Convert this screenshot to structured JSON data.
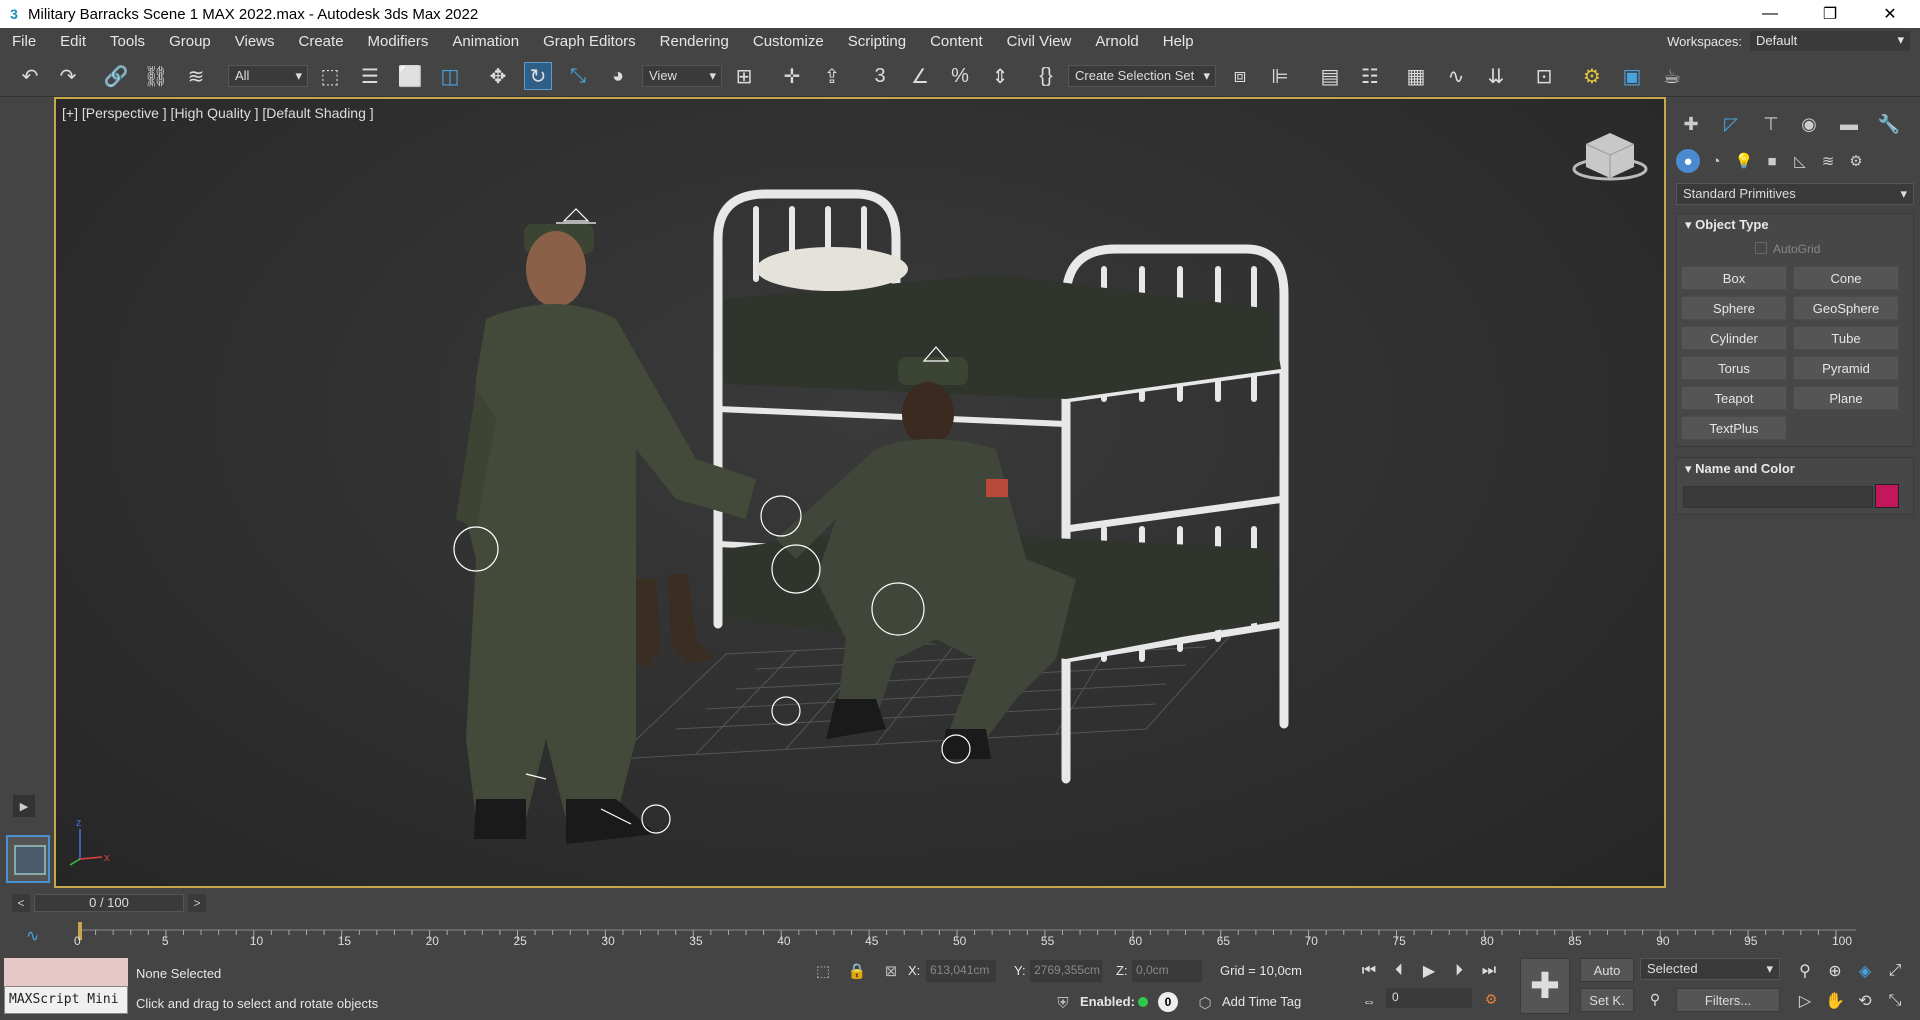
{
  "window": {
    "title": "Military Barracks Scene 1 MAX 2022.max - Autodesk 3ds Max 2022",
    "app_icon": "3",
    "minimize": "—",
    "maximize": "❐",
    "close": "✕"
  },
  "menu": {
    "items": [
      "File",
      "Edit",
      "Tools",
      "Group",
      "Views",
      "Create",
      "Modifiers",
      "Animation",
      "Graph Editors",
      "Rendering",
      "Customize",
      "Scripting",
      "Content",
      "Civil View",
      "Arnold",
      "Help"
    ],
    "workspaces_label": "Workspaces:",
    "workspace_value": "Default"
  },
  "toolbar": {
    "selection_filter": "All",
    "reference_coord": "View",
    "named_selection": "Create Selection Set",
    "icons": [
      "undo-icon",
      "redo-icon",
      "link-icon",
      "unlink-icon",
      "bind-space-warp-icon",
      "select-object-icon",
      "select-by-name-icon",
      "rectangular-selection-icon",
      "window-crossing-icon",
      "move-icon",
      "rotate-icon",
      "scale-icon",
      "place-icon",
      "pivot-icon",
      "manipulate-icon",
      "keyboard-shortcut-icon",
      "snaps-icon",
      "angle-snap-icon",
      "percent-snap-icon",
      "spinner-snap-icon",
      "edit-named-sets-icon",
      "mirror-icon",
      "align-icon",
      "scene-explorer-icon",
      "layer-explorer-icon",
      "ribbon-icon",
      "curve-editor-icon",
      "schematic-view-icon",
      "material-editor-icon",
      "render-setup-icon",
      "rendered-frame-icon",
      "render-icon"
    ]
  },
  "viewport": {
    "label": "[+] [Perspective ] [High Quality ] [Default Shading ]",
    "gizmo_axes": {
      "x": "x",
      "y": "y",
      "z": "z"
    }
  },
  "command_panel": {
    "tabs": [
      "create-tab-icon",
      "modify-tab-icon",
      "hierarchy-tab-icon",
      "motion-tab-icon",
      "display-tab-icon",
      "utilities-tab-icon"
    ],
    "subtabs": [
      "geometry-icon",
      "shapes-icon",
      "lights-icon",
      "cameras-icon",
      "helpers-icon",
      "space-warps-icon",
      "systems-icon"
    ],
    "category": "Standard Primitives",
    "object_type_title": "Object Type",
    "autogrid": "AutoGrid",
    "primitives": [
      "Box",
      "Cone",
      "Sphere",
      "GeoSphere",
      "Cylinder",
      "Tube",
      "Torus",
      "Pyramid",
      "Teapot",
      "Plane",
      "TextPlus"
    ],
    "name_color_title": "Name and Color",
    "object_color": "#c2185b"
  },
  "time": {
    "slider": "0 / 100",
    "prev": "<",
    "next": ">",
    "ticks": [
      "0",
      "5",
      "10",
      "15",
      "20",
      "25",
      "30",
      "35",
      "40",
      "45",
      "50",
      "55",
      "60",
      "65",
      "70",
      "75",
      "80",
      "85",
      "90",
      "95",
      "100"
    ]
  },
  "status": {
    "maxscript": "MAXScript Mini",
    "selection": "None Selected",
    "prompt": "Click and drag to select and rotate objects",
    "x_label": "X:",
    "x_value": "613,041cm",
    "y_label": "Y:",
    "y_value": "2769,355cm",
    "z_label": "Z:",
    "z_value": "0,0cm",
    "grid": "Grid = 10,0cm",
    "enabled_label": "Enabled:",
    "enabled_value": "0",
    "add_time_tag": "Add Time Tag",
    "auto": "Auto",
    "set_key": "Set K.",
    "key_filter": "Selected",
    "filters": "Filters...",
    "current_frame": "0"
  }
}
